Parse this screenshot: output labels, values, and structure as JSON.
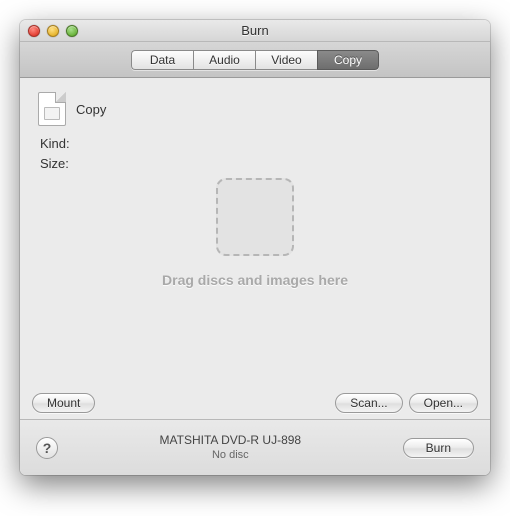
{
  "window": {
    "title": "Burn"
  },
  "tabs": {
    "data": "Data",
    "audio": "Audio",
    "video": "Video",
    "copy": "Copy",
    "active": "copy"
  },
  "file": {
    "name": "Copy",
    "kind_label": "Kind:",
    "kind_value": "",
    "size_label": "Size:",
    "size_value": ""
  },
  "dropzone": {
    "hint": "Drag discs and images here"
  },
  "buttons": {
    "mount": "Mount",
    "scan": "Scan...",
    "open": "Open...",
    "burn": "Burn"
  },
  "drive": {
    "name": "MATSHITA DVD-R UJ-898",
    "status": "No disc"
  },
  "help_glyph": "?"
}
